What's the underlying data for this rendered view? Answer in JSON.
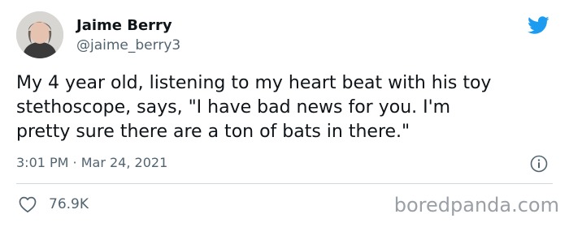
{
  "user": {
    "display_name": "Jaime Berry",
    "handle": "@jaime_berry3"
  },
  "tweet": {
    "text": "My 4 year old, listening to my heart beat with his toy\nstethoscope, says, \"I have bad news for you. I'm\npretty sure there are a ton of bats in there.\"",
    "timestamp": "3:01 PM · Mar 24, 2021",
    "likes": "76.9K"
  },
  "icons": {
    "brand": "twitter-bird-icon",
    "info": "info-icon",
    "like": "heart-icon"
  },
  "colors": {
    "brand": "#1d9bf0",
    "text": "#0f1419",
    "muted": "#536471",
    "divider": "#cfd9de"
  },
  "watermark": "boredpanda.com"
}
